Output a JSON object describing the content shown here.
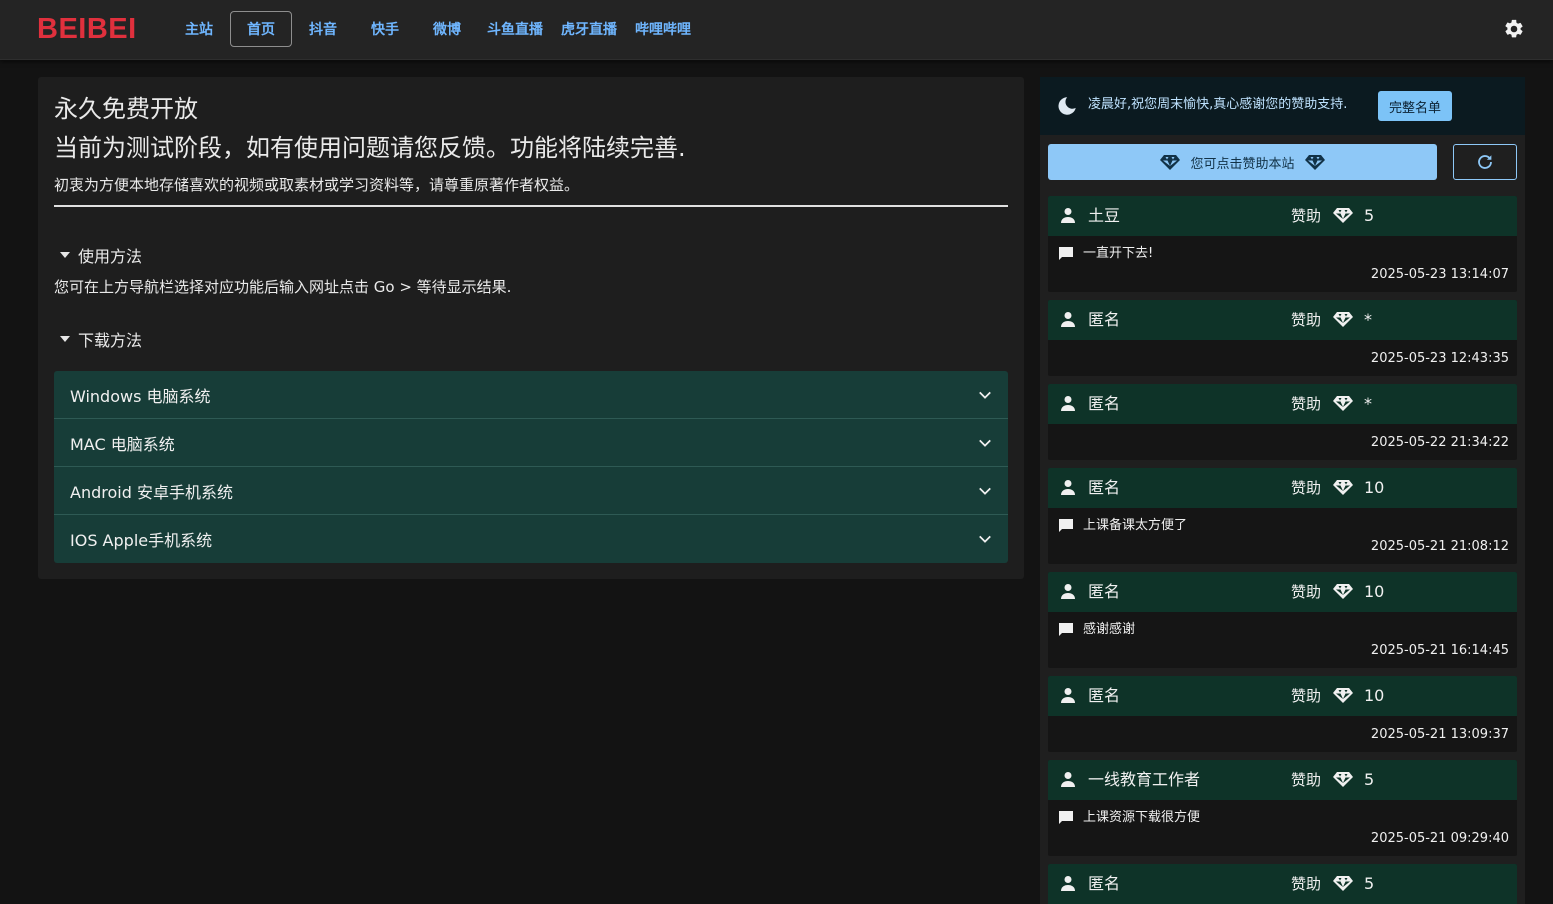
{
  "navbar": {
    "logo": "BEIBEI",
    "items": [
      "主站",
      "首页",
      "抖音",
      "快手",
      "微博",
      "斗鱼直播",
      "虎牙直播",
      "哔哩哔哩"
    ],
    "active": "首页",
    "settings_icon": "gear-icon"
  },
  "intro": {
    "title": "永久免费开放",
    "subtitle": "当前为测试阶段，如有使用问题请您反馈。功能将陆续完善.",
    "note": "初衷为方便本地存储喜欢的视频或取素材或学习资料等，请尊重原著作者权益。",
    "usage_summary": "使用方法",
    "usage_text": "您可在上方导航栏选择对应功能后输入网址点击 Go > 等待显示结果.",
    "download_summary": "下载方法",
    "platforms": [
      "Windows 电脑系统",
      "MAC 电脑系统",
      "Android 安卓手机系统",
      "IOS Apple手机系统"
    ]
  },
  "sidebar": {
    "greeting": "凌晨好,祝您周末愉快,真心感谢您的赞助支持.",
    "full_list_button": "完整名单",
    "sponsor_button": "您可点击赞助本站",
    "sponsor_label": "赞助",
    "donations": [
      {
        "name": "土豆",
        "amount": "5",
        "message": "一直开下去!",
        "time": "2025-05-23 13:14:07"
      },
      {
        "name": "匿名",
        "amount": "*",
        "message": "",
        "time": "2025-05-23 12:43:35"
      },
      {
        "name": "匿名",
        "amount": "*",
        "message": "",
        "time": "2025-05-22 21:34:22"
      },
      {
        "name": "匿名",
        "amount": "10",
        "message": "上课备课太方便了",
        "time": "2025-05-21 21:08:12"
      },
      {
        "name": "匿名",
        "amount": "10",
        "message": "感谢感谢",
        "time": "2025-05-21 16:14:45"
      },
      {
        "name": "匿名",
        "amount": "10",
        "message": "",
        "time": "2025-05-21 13:09:37"
      },
      {
        "name": "一线教育工作者",
        "amount": "5",
        "message": "上课资源下载很方便",
        "time": "2025-05-21 09:29:40"
      },
      {
        "name": "匿名",
        "amount": "5",
        "message": "",
        "time": ""
      }
    ]
  },
  "colors": {
    "logo": "#e0303d",
    "nav_link": "#6fb6ff",
    "accordion_bg": "#173d38",
    "donation_header_bg": "#0e3328",
    "sponsor_button_bg": "#8ec8f7"
  }
}
